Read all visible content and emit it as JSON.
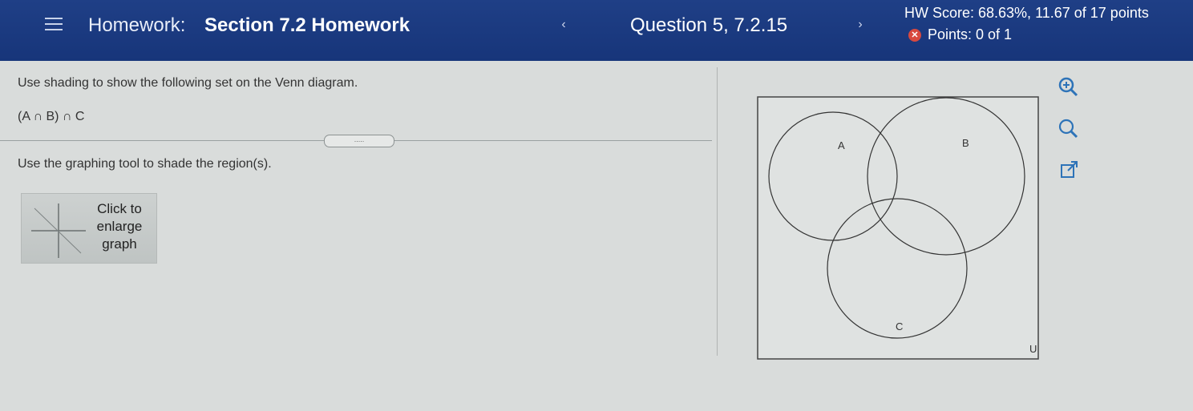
{
  "header": {
    "homework_label": "Homework:",
    "homework_title": "Section 7.2 Homework",
    "prev_glyph": "‹",
    "next_glyph": "›",
    "question": "Question 5, 7.2.15",
    "score": "HW Score: 68.63%, 11.67 of 17 points",
    "points": "Points: 0 of 1",
    "points_status_icon": "x-circle-icon",
    "menu_icon": "hamburger-icon",
    "bg_color": "#1a3a80"
  },
  "question": {
    "instruction": "Use shading to show the following set on the Venn diagram.",
    "expression": "(A ∩ B) ∩ C",
    "divider_handle": ".....",
    "instruction2": "Use the graphing tool to shade the region(s)."
  },
  "enlarge": {
    "line1": "Click to",
    "line2": "enlarge",
    "line3": "graph"
  },
  "venn": {
    "labels": {
      "a": "A",
      "b": "B",
      "c": "C",
      "universe": "U"
    }
  },
  "tools": {
    "zoom_in": "zoom-in-icon",
    "zoom_out": "zoom-out-icon",
    "popout": "popout-icon",
    "accent": "#2d73b8"
  }
}
